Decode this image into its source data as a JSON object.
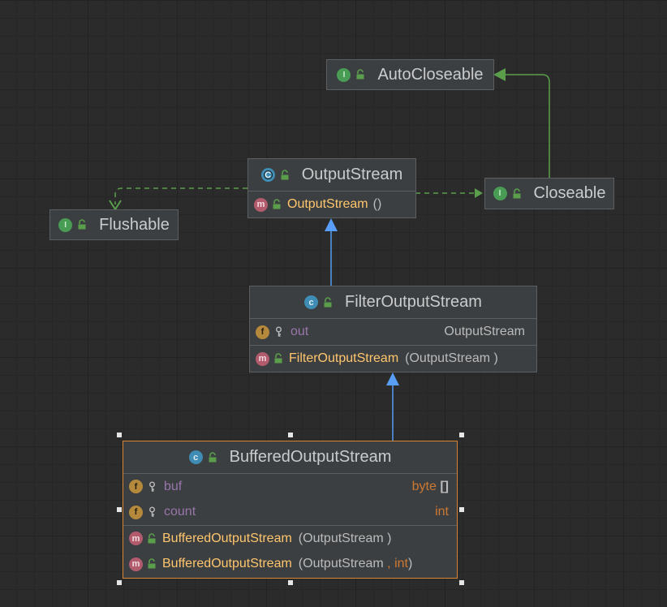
{
  "colors": {
    "inherit_arrow": "#589df6",
    "implement_arrow": "#5a9e4b",
    "selection": "#d9852f",
    "method_name": "#ffc66d",
    "field_name": "#9876aa",
    "keyword": "#cc7832"
  },
  "nodes": {
    "autocloseable": {
      "kind": "interface",
      "title": "AutoCloseable",
      "icon": "interface-icon"
    },
    "closeable": {
      "kind": "interface",
      "title": "Closeable",
      "icon": "interface-icon"
    },
    "flushable": {
      "kind": "interface",
      "title": "Flushable",
      "icon": "interface-icon"
    },
    "outputstream": {
      "kind": "abstract-class",
      "title": "OutputStream",
      "icon": "abstract-class-icon",
      "methods": [
        {
          "name": "OutputStream",
          "params": "()"
        }
      ]
    },
    "filteroutputstream": {
      "kind": "class",
      "title": "FilterOutputStream",
      "icon": "class-icon",
      "fields": [
        {
          "name": "out",
          "type": "OutputStream"
        }
      ],
      "methods": [
        {
          "name": "FilterOutputStream",
          "params": "(OutputStream )"
        }
      ]
    },
    "bufferedoutputstream": {
      "kind": "class",
      "title": "BufferedOutputStream",
      "icon": "class-icon",
      "selected": true,
      "fields": [
        {
          "name": "buf",
          "type_kw": "byte",
          "type_suffix": " []"
        },
        {
          "name": "count",
          "type_kw": "int"
        }
      ],
      "methods": [
        {
          "name": "BufferedOutputStream",
          "params": "(OutputStream )"
        },
        {
          "name": "BufferedOutputStream",
          "params_a": "(OutputStream ",
          "params_kw": ", int",
          "params_b": ")"
        }
      ]
    }
  },
  "edges": [
    {
      "from": "bufferedoutputstream",
      "to": "filteroutputstream",
      "type": "extends"
    },
    {
      "from": "filteroutputstream",
      "to": "outputstream",
      "type": "extends"
    },
    {
      "from": "outputstream",
      "to": "flushable",
      "type": "implements"
    },
    {
      "from": "outputstream",
      "to": "closeable",
      "type": "implements"
    },
    {
      "from": "closeable",
      "to": "autocloseable",
      "type": "extends"
    }
  ]
}
